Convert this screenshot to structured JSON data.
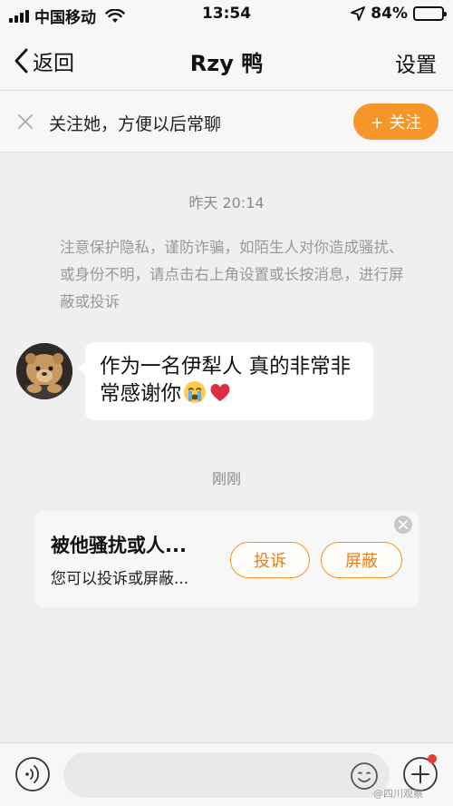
{
  "status_bar": {
    "carrier": "中国移动",
    "time": "13:54",
    "battery_percent": "84%",
    "battery_level": 0.84
  },
  "nav": {
    "back_label": "返回",
    "title": "Rzy 鸭",
    "settings_label": "设置"
  },
  "follow_banner": {
    "text": "关注她，方便以后常聊",
    "follow_button": "+ 关注"
  },
  "chat": {
    "timestamp_1": "昨天 20:14",
    "safety_notice": "注意保护隐私，谨防诈骗，如陌生人对你造成骚扰、或身份不明，请点击右上角设置或长按消息，进行屏蔽或投诉",
    "message_text": "作为一名伊犁人 真的非常非常感谢你",
    "message_emojis": [
      "crying-face",
      "red-heart"
    ],
    "timestamp_2": "刚刚"
  },
  "report_card": {
    "title": "被他骚扰或人...",
    "subtitle": "您可以投诉或屏蔽...",
    "report_button": "投诉",
    "block_button": "屏蔽"
  },
  "input_bar": {
    "placeholder": "",
    "value": ""
  },
  "watermark": "@四川观察",
  "colors": {
    "accent_orange": "#f5952a",
    "background": "#efefef",
    "notification_red": "#e63b2e"
  }
}
